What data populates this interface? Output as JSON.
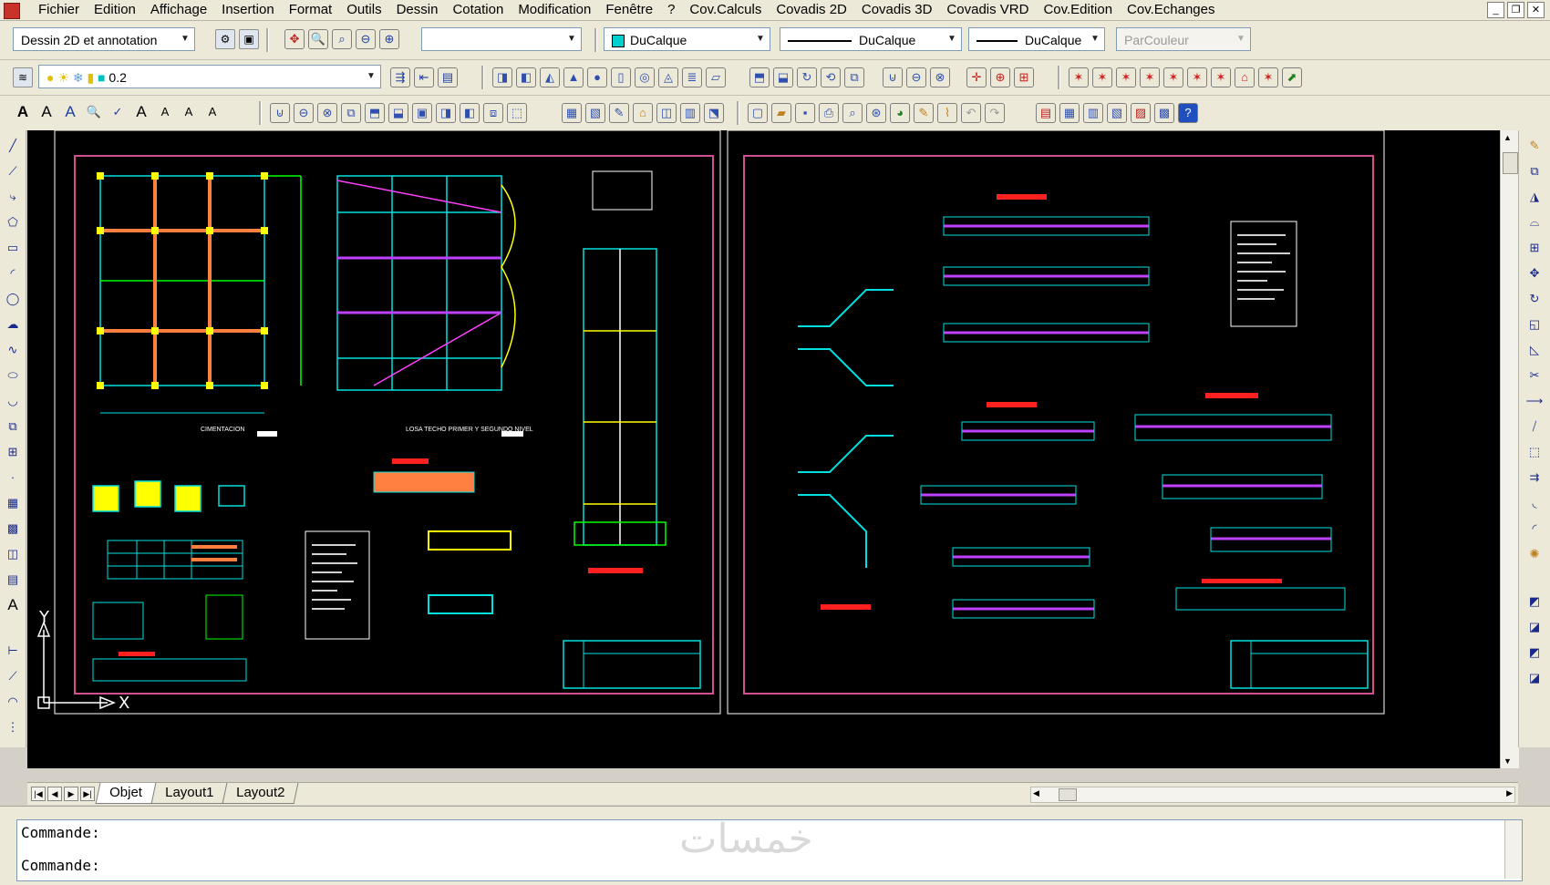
{
  "menubar": {
    "items": [
      "Fichier",
      "Edition",
      "Affichage",
      "Insertion",
      "Format",
      "Outils",
      "Dessin",
      "Cotation",
      "Modification",
      "Fenêtre",
      "?",
      "Cov.Calculs",
      "Covadis 2D",
      "Covadis 3D",
      "Covadis VRD",
      "Cov.Edition",
      "Cov.Echanges"
    ]
  },
  "toolbar": {
    "workspace": "Dessin 2D et annotation",
    "layer_value": "0.2",
    "color": "DuCalque",
    "linetype": "DuCalque",
    "lineweight": "DuCalque",
    "plotstyle": "ParCouleur",
    "color_swatch": "#00d0d0"
  },
  "drawing": {
    "background": "#000000",
    "plan_label_1": "CIMENTACION",
    "plan_label_2": "LOSA TECHO PRIMER Y SEGUNDO NIVEL",
    "ucs_y": "Y",
    "ucs_x": "X"
  },
  "tabs": [
    "Objet",
    "Layout1",
    "Layout2"
  ],
  "command": {
    "line1": "Commande:",
    "line2": "Commande:"
  },
  "watermark": "خمسات"
}
